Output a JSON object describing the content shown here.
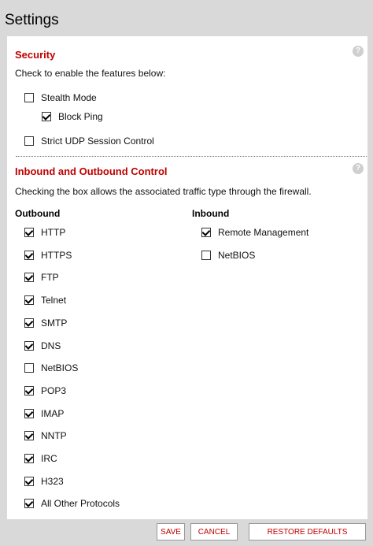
{
  "title": "Settings",
  "security": {
    "title": "Security",
    "help": "?",
    "description": "Check to enable the features below:",
    "stealth_mode": {
      "label": "Stealth Mode",
      "checked": false
    },
    "block_ping": {
      "label": "Block Ping",
      "checked": true
    },
    "strict_udp": {
      "label": "Strict UDP Session Control",
      "checked": false
    }
  },
  "control": {
    "title": "Inbound and Outbound Control",
    "help": "?",
    "description": "Checking the box allows the associated traffic type through the firewall.",
    "outbound_heading": "Outbound",
    "inbound_heading": "Inbound",
    "outbound": [
      {
        "label": "HTTP",
        "checked": true
      },
      {
        "label": "HTTPS",
        "checked": true
      },
      {
        "label": "FTP",
        "checked": true
      },
      {
        "label": "Telnet",
        "checked": true
      },
      {
        "label": "SMTP",
        "checked": true
      },
      {
        "label": "DNS",
        "checked": true
      },
      {
        "label": "NetBIOS",
        "checked": false
      },
      {
        "label": "POP3",
        "checked": true
      },
      {
        "label": "IMAP",
        "checked": true
      },
      {
        "label": "NNTP",
        "checked": true
      },
      {
        "label": "IRC",
        "checked": true
      },
      {
        "label": "H323",
        "checked": true
      },
      {
        "label": "All Other Protocols",
        "checked": true
      }
    ],
    "inbound": [
      {
        "label": "Remote Management",
        "checked": true
      },
      {
        "label": "NetBIOS",
        "checked": false
      }
    ]
  },
  "buttons": {
    "save": "SAVE",
    "cancel": "CANCEL",
    "restore": "RESTORE DEFAULTS"
  }
}
